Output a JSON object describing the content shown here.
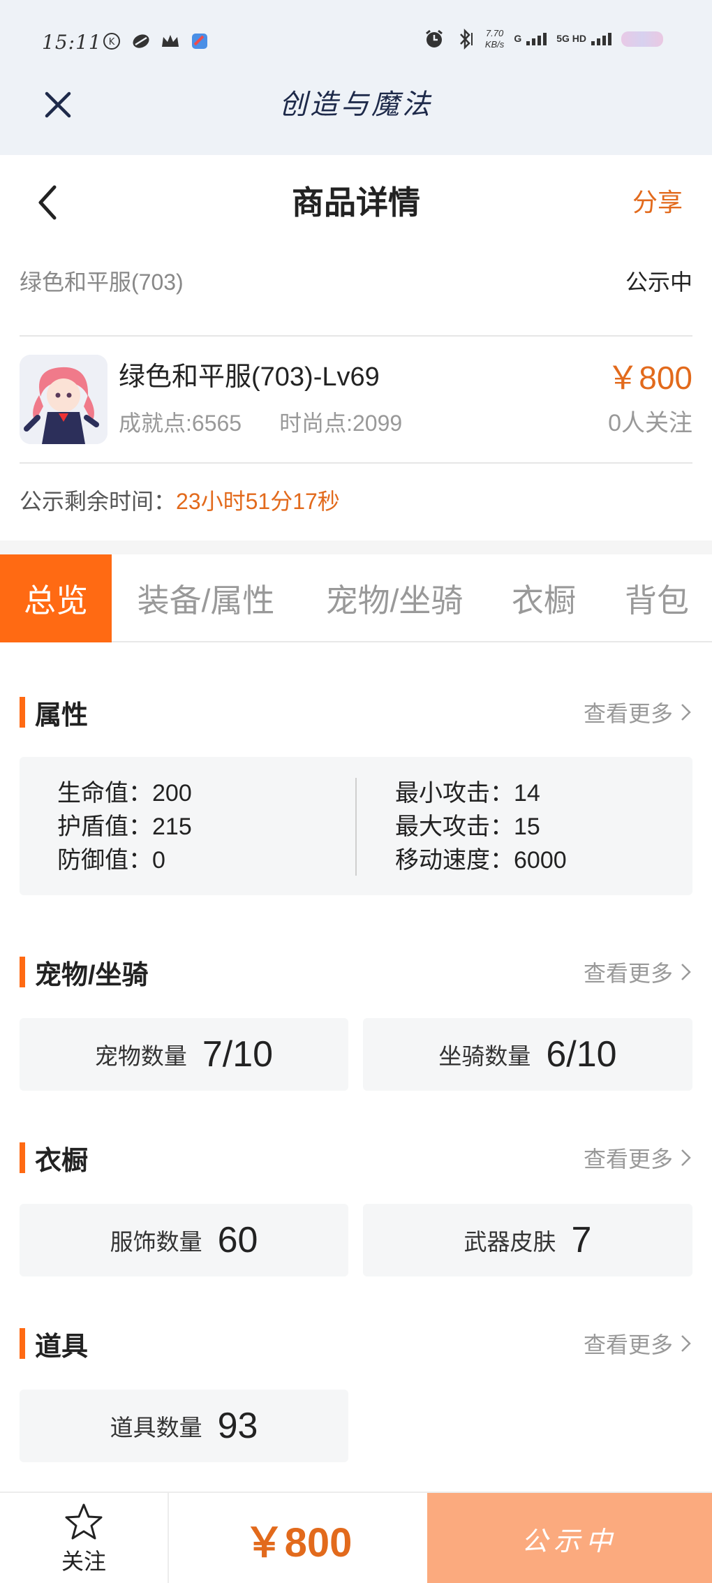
{
  "status_bar": {
    "time": "15:11",
    "net_speed": "7.70",
    "net_unit": "KB/s",
    "signal_1": "G",
    "signal_2": "5G HD"
  },
  "app": {
    "title": "创造与魔法"
  },
  "nav": {
    "title": "商品详情",
    "share": "分享"
  },
  "item": {
    "name": "绿色和平服(703)",
    "status": "公示中",
    "title": "绿色和平服(703)-Lv69",
    "achievement": "成就点:6565",
    "fashion": "时尚点:2099",
    "price": "￥800",
    "watchers": "0人关注",
    "countdown_label": "公示剩余时间：",
    "countdown_value": "23小时51分17秒"
  },
  "tabs": [
    "总览",
    "装备/属性",
    "宠物/坐骑",
    "衣橱",
    "背包"
  ],
  "more_label": "查看更多",
  "sections": {
    "attributes": {
      "title": "属性",
      "left": [
        "生命值：200",
        "护盾值：215",
        "防御值：0"
      ],
      "right": [
        "最小攻击：14",
        "最大攻击：15",
        "移动速度：6000"
      ]
    },
    "pets": {
      "title": "宠物/坐骑",
      "cards": [
        {
          "label": "宠物数量",
          "value": "7/10"
        },
        {
          "label": "坐骑数量",
          "value": "6/10"
        }
      ]
    },
    "wardrobe": {
      "title": "衣橱",
      "cards": [
        {
          "label": "服饰数量",
          "value": "60"
        },
        {
          "label": "武器皮肤",
          "value": "7"
        }
      ]
    },
    "props": {
      "title": "道具",
      "cards": [
        {
          "label": "道具数量",
          "value": "93"
        }
      ]
    }
  },
  "bottom": {
    "follow": "关注",
    "price": "￥800",
    "status": "公示中"
  },
  "colors": {
    "accent": "#ff6a13",
    "price": "#e26a1c",
    "status_button": "#fbaa7e"
  }
}
